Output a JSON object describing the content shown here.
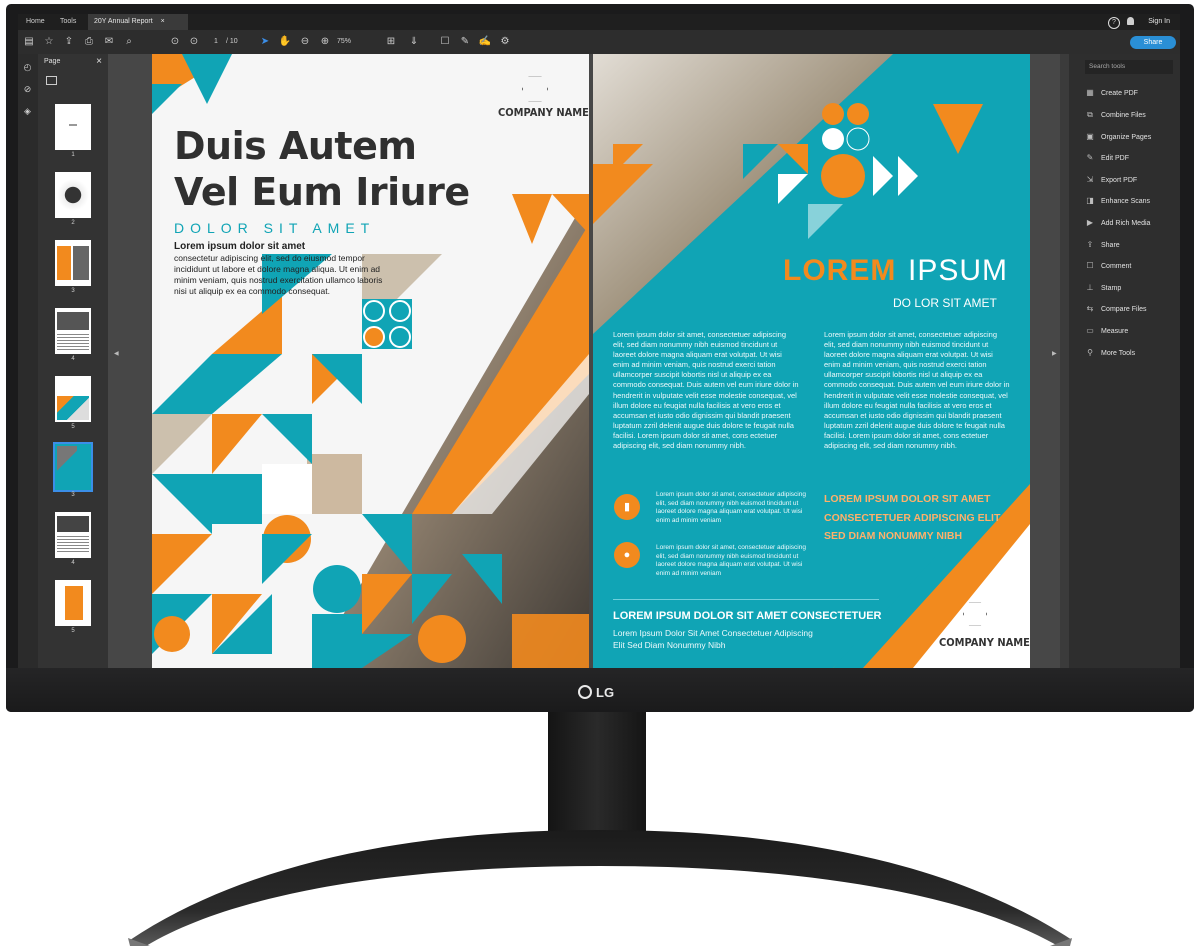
{
  "brand": {
    "logo": "LG"
  },
  "app": {
    "tabs": [
      {
        "label": "Home"
      },
      {
        "label": "Tools"
      },
      {
        "label": "20Y Annual Report"
      }
    ],
    "tab_close": "×",
    "sign_in": "Sign In",
    "help": "?",
    "share": "Share"
  },
  "toolbar": {
    "page_current": "1",
    "page_total": "/ 10",
    "zoom": "75%"
  },
  "icons": {
    "save": "▤",
    "star": "☆",
    "upload": "⇪",
    "print": "⎙",
    "mail": "✉",
    "zoom_search": "⌕",
    "prev": "⊙",
    "next": "⊙",
    "select": "➤",
    "hand": "✋",
    "zoom_out": "⊖",
    "zoom_in": "⊕",
    "fit": "⊞",
    "scroll": "⇓",
    "comment": "☐",
    "pen": "✎",
    "sign": "✍",
    "more": "⚙",
    "rail_pages": "◴",
    "rail_attach": "⊘",
    "rail_layers": "◈"
  },
  "thumb_panel": {
    "title": "Page",
    "close": "×",
    "pages": [
      "1",
      "2",
      "3",
      "4",
      "5",
      "3",
      "4",
      "5"
    ]
  },
  "left_page": {
    "title_line1": "Duis Autem",
    "title_line2": "Vel Eum Iriure",
    "subtitle": "DOLOR SIT AMET",
    "lead": "Lorem ipsum dolor sit amet",
    "body": "consectetur adipiscing elit, sed do eiusmod tempor incididunt ut labore et dolore magna aliqua. Ut enim ad minim veniam, quis nostrud exercitation ullamco laboris nisi ut aliquip ex ea commodo consequat.",
    "company": "COMPANY NAME"
  },
  "right_page": {
    "title_orange": "LOREM",
    "title_white": "IPSUM",
    "subtitle": "DO LOR SIT AMET",
    "col1": "Lorem ipsum dolor sit amet, consectetuer adipiscing elit, sed diam nonummy nibh euismod tincidunt ut laoreet dolore magna aliquam erat volutpat. Ut wisi enim ad minim veniam, quis nostrud exerci tation ullamcorper suscipit lobortis nisl ut aliquip ex ea commodo consequat. Duis autem vel eum iriure dolor in hendrerit in vulputate velit esse molestie consequat, vel illum dolore eu feugiat nulla facilisis at vero eros et accumsan et iusto odio dignissim qui blandit praesent luptatum zzril delenit augue duis dolore te feugait nulla facilisi. Lorem ipsum dolor sit amet, cons ectetuer adipiscing elit, sed diam nonummy nibh.",
    "col2": "Lorem ipsum dolor sit amet, consectetuer adipiscing elit, sed diam nonummy nibh euismod tincidunt ut laoreet dolore magna aliquam erat volutpat. Ut wisi enim ad minim veniam, quis nostrud exerci tation ullamcorper suscipit lobortis nisl ut aliquip ex ea commodo consequat. Duis autem vel eum iriure dolor in hendrerit in vulputate velit esse molestie consequat, vel illum dolore eu feugiat nulla facilisis at vero eros et accumsan et iusto odio dignissim qui blandit praesent luptatum zzril delenit augue duis dolore te feugait nulla facilisi. Lorem ipsum dolor sit amet, cons ectetuer adipiscing elit, sed diam nonummy nibh.",
    "caps_lines": [
      "LOREM IPSUM DOLOR SIT AMET",
      "CONSECTETUER ADIPISCING ELIT",
      "SED DIAM NONUMMY NIBH"
    ],
    "bullet1": "Lorem ipsum dolor sit amet, consectetuer adipiscing elit, sed diam nonummy nibh euismod tincidunt ut laoreet dolore magna aliquam erat volutpat. Ut wisi enim ad minim veniam",
    "bullet2": "Lorem ipsum dolor sit amet, consectetuer adipiscing elit, sed diam nonummy nibh euismod tincidunt ut laoreet dolore magna aliquam erat volutpat. Ut wisi enim ad minim veniam",
    "footer_caps": "LOREM IPSUM DOLOR SIT AMET CONSECTETUER",
    "footer_small": "Lorem Ipsum Dolor Sit Amet Consectetuer Adipiscing Elit Sed Diam Nonummy Nibh",
    "company": "COMPANY NAME"
  },
  "tools_panel": {
    "search_placeholder": "Search tools",
    "items": [
      {
        "label": "Create PDF",
        "icon": "▦"
      },
      {
        "label": "Combine Files",
        "icon": "⧉"
      },
      {
        "label": "Organize Pages",
        "icon": "▣"
      },
      {
        "label": "Edit PDF",
        "icon": "✎"
      },
      {
        "label": "Export PDF",
        "icon": "⇲"
      },
      {
        "label": "Enhance Scans",
        "icon": "◨"
      },
      {
        "label": "Add Rich Media",
        "icon": "▶"
      },
      {
        "label": "Share",
        "icon": "⇪"
      },
      {
        "label": "Comment",
        "icon": "☐"
      },
      {
        "label": "Stamp",
        "icon": "⊥"
      },
      {
        "label": "Compare Files",
        "icon": "⇆"
      },
      {
        "label": "Measure",
        "icon": "▭"
      },
      {
        "label": "More Tools",
        "icon": "⚲"
      }
    ]
  },
  "colors": {
    "orange": "#f28a1e",
    "teal": "#10a4b5",
    "accent_blue": "#2a8fd6"
  }
}
